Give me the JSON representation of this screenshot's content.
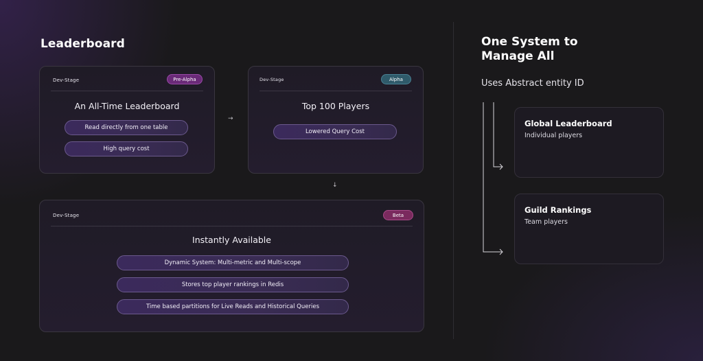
{
  "leaderboard": {
    "heading": "Leaderboard",
    "cards": [
      {
        "stage_label": "Dev-Stage",
        "badge": "Pre-Alpha",
        "title": "An All-Time Leaderboard",
        "items": [
          "Read directly from one table",
          "High query cost"
        ]
      },
      {
        "stage_label": "Dev-Stage",
        "badge": "Alpha",
        "title": "Top 100 Players",
        "items": [
          "Lowered Query Cost"
        ]
      },
      {
        "stage_label": "Dev-Stage",
        "badge": "Beta",
        "title": "Instantly Available",
        "items": [
          "Dynamic System: Multi-metric and Multi-scope",
          "Stores top player rankings in Redis",
          "Time based partitions for Live Reads and Historical Queries"
        ]
      }
    ],
    "arrows": {
      "right": "→",
      "down": "↓"
    }
  },
  "system": {
    "title_line1": "One System to",
    "title_line2": "Manage All",
    "subtitle": "Uses Abstract entity ID",
    "entities": [
      {
        "title": "Global Leaderboard",
        "subtitle": "Individual players"
      },
      {
        "title": "Guild Rankings",
        "subtitle": "Team players"
      }
    ]
  },
  "colors": {
    "background": "#1a191b",
    "badge_pre_alpha": "#6a2a78",
    "badge_alpha": "#2f5a6a",
    "badge_beta": "#7a2a5e",
    "pill_border": "#6c5a8e"
  }
}
